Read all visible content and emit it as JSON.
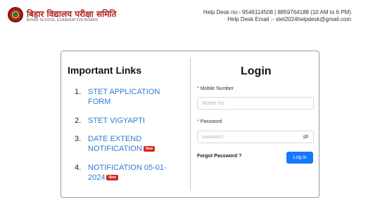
{
  "header": {
    "brand_hindi": "बिहार विद्यालय परीक्षा समिति",
    "brand_english": "BIHAR SCHOOL EXAMINATION BOARD",
    "helpdesk_numbers": "Help Desk no:- 9546114508 | 8859764188 (10 AM to 6 PM)",
    "helpdesk_email": "Help Desk Email :- stet2024helpdesk@gmail.com"
  },
  "important_links": {
    "title": "Important Links",
    "items": [
      {
        "num": "1.",
        "label": "STET APPLICATION FORM",
        "badge": ""
      },
      {
        "num": "2.",
        "label": "STET VIGYAPTI",
        "badge": ""
      },
      {
        "num": "3.",
        "label": "DATE EXTEND NOTIFICATION",
        "badge": "New"
      },
      {
        "num": "4.",
        "label": "NOTIFICATION 05-01-2024",
        "badge": "New"
      }
    ]
  },
  "login": {
    "title": "Login",
    "mobile_label": "Mobile Number",
    "mobile_placeholder": "Mobile No.",
    "mobile_value": "",
    "password_label": "Password",
    "password_placeholder": "password",
    "password_value": "",
    "required_mark": "*",
    "forgot_label": "Forgot Password ?",
    "submit_label": "Log in"
  },
  "icons": {
    "eye": "eye-invisible-icon",
    "logo": "bseb-emblem-icon"
  }
}
